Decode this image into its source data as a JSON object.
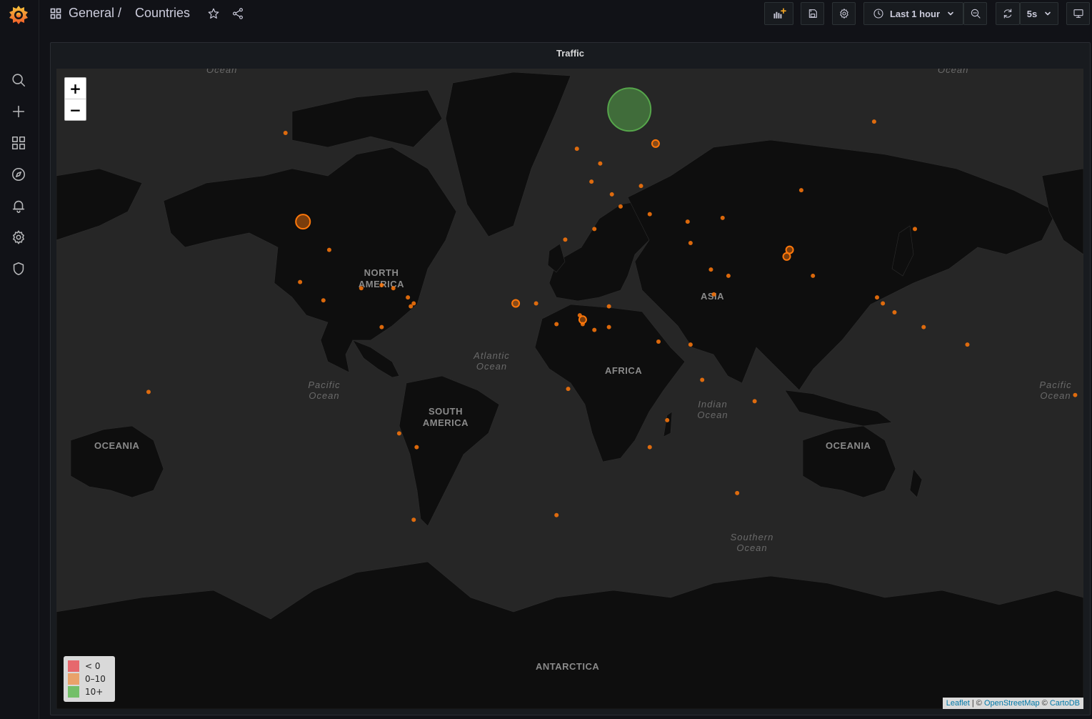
{
  "breadcrumb": {
    "folder": "General",
    "separator": "/",
    "title": "Countries"
  },
  "toolbar": {
    "time_range": "Last 1 hour",
    "refresh_interval": "5s"
  },
  "sidebar": {
    "items": [
      {
        "name": "search-icon"
      },
      {
        "name": "plus-icon"
      },
      {
        "name": "dashboards-icon"
      },
      {
        "name": "explore-icon"
      },
      {
        "name": "alerting-icon"
      },
      {
        "name": "settings-icon"
      },
      {
        "name": "shield-icon"
      }
    ]
  },
  "panel": {
    "title": "Traffic"
  },
  "map": {
    "zoom_in": "+",
    "zoom_out": "−",
    "labels": {
      "north_america": "NORTH AMERICA",
      "south_america": "SOUTH AMERICA",
      "africa": "AFRICA",
      "asia": "ASIA",
      "oceania_left": "OCEANIA",
      "oceania_right": "OCEANIA",
      "antarctica": "ANTARCTICA",
      "atlantic": "Atlantic Ocean",
      "pacific_left": "Pacific Ocean",
      "pacific_right": "Pacific Ocean",
      "indian": "Indian Ocean",
      "southern": "Southern Ocean",
      "arctic_left": "Ocean",
      "arctic_right": "Ocean"
    },
    "legend": [
      {
        "label": "< 0",
        "color": "#e6686d"
      },
      {
        "label": "0–10",
        "color": "#e9a26a"
      },
      {
        "label": "10+",
        "color": "#73bf69"
      }
    ],
    "attribution": {
      "leaflet": "Leaflet",
      "sep1": " | © ",
      "osm": "OpenStreetMap",
      "sep2": " © ",
      "carto": "CartoDB"
    },
    "markers": [
      {
        "lat": 62.0,
        "lon": 15.0,
        "value": 25
      },
      {
        "lat": 38.0,
        "lon": -97.0,
        "value": 8
      },
      {
        "lat": 56.0,
        "lon": 24.0,
        "value": 5
      },
      {
        "lat": 30.0,
        "lon": 70.0,
        "value": 5
      },
      {
        "lat": 28.0,
        "lon": 69.0,
        "value": 5
      },
      {
        "lat": 13.0,
        "lon": -24.0,
        "value": 5
      },
      {
        "lat": 7.5,
        "lon": -1.0,
        "value": 5
      }
    ]
  },
  "colors": {
    "accent_orange": "#ff780a",
    "accent_green": "#56a64b"
  }
}
